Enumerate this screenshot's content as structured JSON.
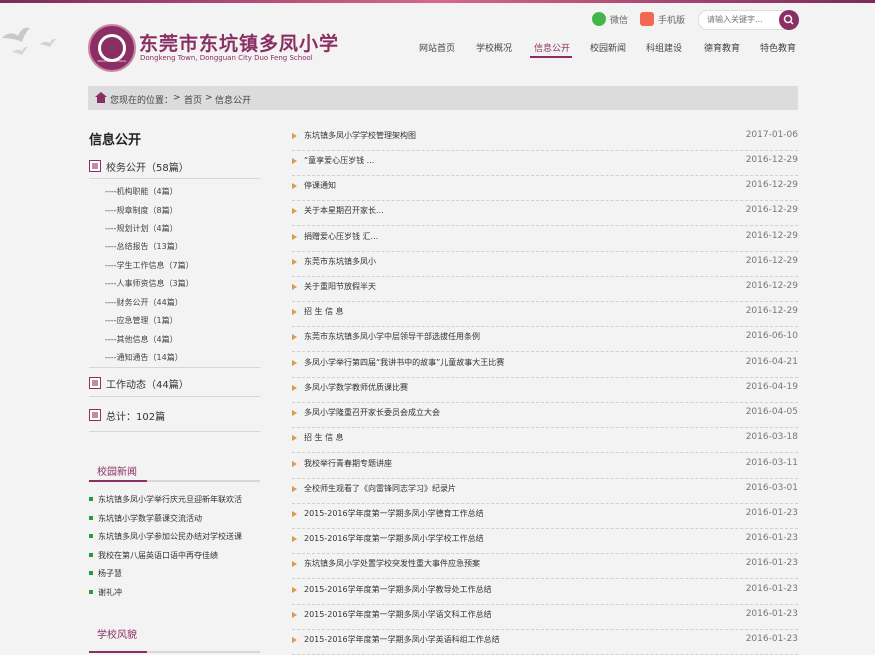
{
  "colors": {
    "brand": "#8a2f63",
    "bullet": "#2a9b3a",
    "arrow": "#d89a4f"
  },
  "header": {
    "logo_text": "DUOFENG SCHOOL",
    "school_name_cn": "东莞市东坑镇多凤小学",
    "school_name_en": "Dongkeng Town, Dongguan City Duo Feng School",
    "wechat_label": "微信",
    "mobile_label": "手机版",
    "search_placeholder": "请输入关键字..."
  },
  "nav": [
    {
      "label": "网站首页"
    },
    {
      "label": "学校概况"
    },
    {
      "label": "信息公开",
      "active": true
    },
    {
      "label": "校园新闻"
    },
    {
      "label": "科组建设"
    },
    {
      "label": "德育教育"
    },
    {
      "label": "特色教育"
    }
  ],
  "breadcrumb": {
    "prefix": "您现在的位置：",
    "sep": ">",
    "home": "首页",
    "current": "信息公开"
  },
  "sidebar": {
    "title": "信息公开",
    "category_main": "校务公开（58篇）",
    "subitems": [
      "----机构职能（4篇）",
      "----规章制度（8篇）",
      "----规划计划（4篇）",
      "----总结报告（13篇）",
      "----学生工作信息（7篇）",
      "----人事师资信息（3篇）",
      "----财务公开（44篇）",
      "----应急管理（1篇）",
      "----其他信息（4篇）",
      "----通知通告（14篇）"
    ],
    "category_work": "工作动态（44篇）",
    "total": "总计：102篇",
    "campus_news_title": "校园新闻",
    "campus_news": [
      "东坑镇多凤小学举行庆元旦迎新年联欢活",
      "东坑镇小学数学慕课交流活动",
      "东坑镇多凤小学参加公民办结对学校送课",
      "我校在第八届英语口语中再夺佳绩",
      "杨子慧",
      "谢礼冲"
    ],
    "school_style_title": "学校风貌"
  },
  "list": [
    {
      "title": "东坑镇多凤小学学校管理架构图",
      "date": "2017-01-06"
    },
    {
      "title": "“童享爱心压岁钱 ...",
      "date": "2016-12-29"
    },
    {
      "title": "停课通知",
      "date": "2016-12-29"
    },
    {
      "title": "关于本星期召开家长...",
      "date": "2016-12-29"
    },
    {
      "title": "捐赠爱心压岁钱 汇...",
      "date": "2016-12-29"
    },
    {
      "title": "东莞市东坑镇多凤小",
      "date": "2016-12-29"
    },
    {
      "title": "关于重阳节放假半天",
      "date": "2016-12-29"
    },
    {
      "title": "招 生 信 息",
      "date": "2016-12-29"
    },
    {
      "title": "东莞市东坑镇多凤小学中层领导干部选拔任用条例",
      "date": "2016-06-10"
    },
    {
      "title": "多凤小学举行第四届“我讲书中的故事”儿童故事大王比赛",
      "date": "2016-04-21"
    },
    {
      "title": "多凤小学数学教师优质课比赛",
      "date": "2016-04-19"
    },
    {
      "title": "多凤小学隆重召开家长委员会成立大会",
      "date": "2016-04-05"
    },
    {
      "title": "招 生 信 息",
      "date": "2016-03-18"
    },
    {
      "title": "我校举行青春期专题讲座",
      "date": "2016-03-11"
    },
    {
      "title": "全校师生观看了《向雷锋同志学习》纪录片",
      "date": "2016-03-01"
    },
    {
      "title": "2015-2016学年度第一学期多凤小学德育工作总结",
      "date": "2016-01-23"
    },
    {
      "title": "2015-2016学年度第一学期多凤小学学校工作总结",
      "date": "2016-01-23"
    },
    {
      "title": "东坑镇多凤小学处置学校突发性重大事件应急预案",
      "date": "2016-01-23"
    },
    {
      "title": "2015-2016学年度第一学期多凤小学教导处工作总结",
      "date": "2016-01-23"
    },
    {
      "title": "2015-2016学年度第一学期多凤小学语文科工作总结",
      "date": "2016-01-23"
    },
    {
      "title": "2015-2016学年度第一学期多凤小学英语科组工作总结",
      "date": "2016-01-23"
    }
  ]
}
